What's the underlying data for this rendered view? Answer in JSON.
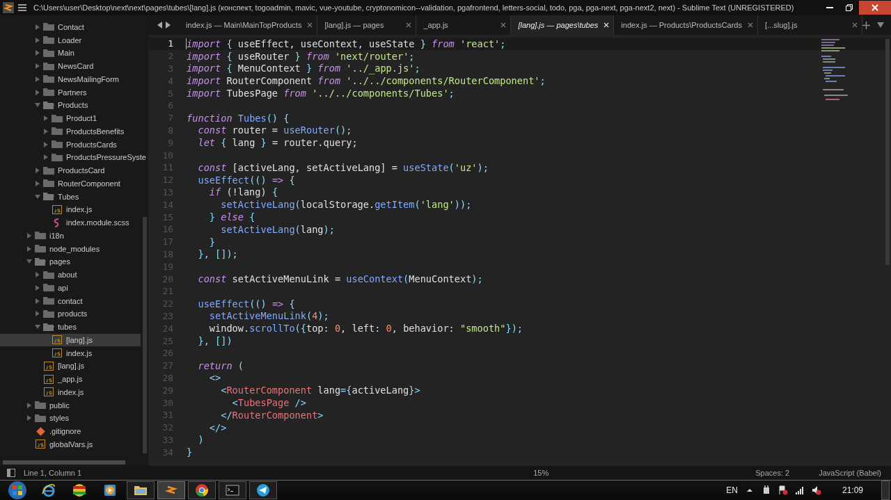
{
  "window": {
    "title": "C:\\Users\\user\\Desktop\\next\\next\\pages\\tubes\\[lang].js (конспект, togoadmin, mavic, vue-youtube, cryptonomicon--validation, pgafrontend, letters-social, todo, pga, pga-next, pga-next2, next) - Sublime Text (UNREGISTERED)"
  },
  "sidebar": {
    "partial_folder_children": [
      {
        "kind": "folder",
        "name": "Contact",
        "expanded": false,
        "selected": false
      },
      {
        "kind": "folder",
        "name": "Loader",
        "expanded": false,
        "selected": false
      },
      {
        "kind": "folder",
        "name": "Main",
        "expanded": false,
        "selected": false
      },
      {
        "kind": "folder",
        "name": "NewsCard",
        "expanded": false,
        "selected": false
      },
      {
        "kind": "folder",
        "name": "NewsMailingForm",
        "expanded": false,
        "selected": false
      },
      {
        "kind": "folder",
        "name": "Partners",
        "expanded": false,
        "selected": false
      },
      {
        "kind": "folder",
        "name": "Products",
        "expanded": true,
        "selected": false,
        "children": [
          {
            "kind": "folder",
            "name": "Product1",
            "expanded": false,
            "selected": false
          },
          {
            "kind": "folder",
            "name": "ProductsBenefits",
            "expanded": false,
            "selected": false
          },
          {
            "kind": "folder",
            "name": "ProductsCards",
            "expanded": false,
            "selected": false
          },
          {
            "kind": "folder",
            "name": "ProductsPressureSyste",
            "expanded": false,
            "selected": false
          }
        ]
      },
      {
        "kind": "folder",
        "name": "ProductsCard",
        "expanded": false,
        "selected": false
      },
      {
        "kind": "folder",
        "name": "RouterComponent",
        "expanded": false,
        "selected": false
      },
      {
        "kind": "folder",
        "name": "Tubes",
        "expanded": true,
        "selected": false,
        "children": [
          {
            "kind": "js",
            "name": "index.js",
            "selected": false
          },
          {
            "kind": "scss",
            "name": "index.module.scss",
            "selected": false
          }
        ]
      }
    ],
    "items": [
      {
        "kind": "folder",
        "name": "i18n",
        "expanded": false,
        "selected": false
      },
      {
        "kind": "folder",
        "name": "node_modules",
        "expanded": false,
        "selected": false
      },
      {
        "kind": "folder",
        "name": "pages",
        "expanded": true,
        "selected": false,
        "children": [
          {
            "kind": "folder",
            "name": "about",
            "expanded": false,
            "selected": false
          },
          {
            "kind": "folder",
            "name": "api",
            "expanded": false,
            "selected": false
          },
          {
            "kind": "folder",
            "name": "contact",
            "expanded": false,
            "selected": false
          },
          {
            "kind": "folder",
            "name": "products",
            "expanded": false,
            "selected": false
          },
          {
            "kind": "folder",
            "name": "tubes",
            "expanded": true,
            "selected": false,
            "children": [
              {
                "kind": "js",
                "name": "[lang].js",
                "selected": true
              },
              {
                "kind": "js",
                "name": "index.js",
                "selected": false
              }
            ]
          },
          {
            "kind": "js",
            "name": "[lang].js",
            "selected": false
          },
          {
            "kind": "js",
            "name": "_app.js",
            "selected": false
          },
          {
            "kind": "js",
            "name": "index.js",
            "selected": false
          }
        ]
      },
      {
        "kind": "folder",
        "name": "public",
        "expanded": false,
        "selected": false
      },
      {
        "kind": "folder",
        "name": "styles",
        "expanded": false,
        "selected": false
      },
      {
        "kind": "git",
        "name": ".gitignore",
        "selected": false
      },
      {
        "kind": "js",
        "name": "globalVars.js",
        "selected": false
      }
    ]
  },
  "tabs": [
    {
      "label": "index.js — Main\\MainTopProducts",
      "selected": false
    },
    {
      "label": "[lang].js — pages",
      "selected": false
    },
    {
      "label": "_app.js",
      "selected": false
    },
    {
      "label": "[lang].js — pages\\tubes",
      "selected": true
    },
    {
      "label": "index.js — Products\\ProductsCards",
      "selected": false
    },
    {
      "label": "[...slug].js",
      "selected": false
    }
  ],
  "editor": {
    "lines": [
      {
        "number": "1",
        "current": true,
        "tokens": [
          {
            "kind": "kw",
            "text": "import"
          },
          {
            "kind": "p",
            "text": " { "
          },
          {
            "kind": "pl",
            "text": "useEffect, useContext, useState"
          },
          {
            "kind": "p",
            "text": " } "
          },
          {
            "kind": "kw",
            "text": "from"
          },
          {
            "kind": "str",
            "text": " 'react'"
          },
          {
            "kind": "p",
            "text": ";"
          }
        ]
      },
      {
        "number": "2",
        "current": false,
        "tokens": [
          {
            "kind": "kw",
            "text": "import"
          },
          {
            "kind": "p",
            "text": " { "
          },
          {
            "kind": "pl",
            "text": "useRouter"
          },
          {
            "kind": "p",
            "text": " } "
          },
          {
            "kind": "kw",
            "text": "from"
          },
          {
            "kind": "str",
            "text": " 'next/router'"
          },
          {
            "kind": "p",
            "text": ";"
          }
        ]
      },
      {
        "number": "3",
        "current": false,
        "tokens": [
          {
            "kind": "kw",
            "text": "import"
          },
          {
            "kind": "p",
            "text": " { "
          },
          {
            "kind": "pl",
            "text": "MenuContext"
          },
          {
            "kind": "p",
            "text": " } "
          },
          {
            "kind": "kw",
            "text": "from"
          },
          {
            "kind": "str",
            "text": " '../_app.js'"
          },
          {
            "kind": "p",
            "text": ";"
          }
        ]
      },
      {
        "number": "4",
        "current": false,
        "tokens": [
          {
            "kind": "kw",
            "text": "import"
          },
          {
            "kind": "pl",
            "text": " RouterComponent "
          },
          {
            "kind": "kw",
            "text": "from"
          },
          {
            "kind": "str",
            "text": " '../../components/RouterComponent'"
          },
          {
            "kind": "p",
            "text": ";"
          }
        ]
      },
      {
        "number": "5",
        "current": false,
        "tokens": [
          {
            "kind": "kw",
            "text": "import"
          },
          {
            "kind": "pl",
            "text": " TubesPage "
          },
          {
            "kind": "kw",
            "text": "from"
          },
          {
            "kind": "str",
            "text": " '../../components/Tubes'"
          },
          {
            "kind": "p",
            "text": ";"
          }
        ]
      },
      {
        "number": "6",
        "current": false
      },
      {
        "number": "7",
        "current": false,
        "tokens": [
          {
            "kind": "kw",
            "text": "function"
          },
          {
            "kind": "fn",
            "text": " Tubes"
          },
          {
            "kind": "p",
            "text": "() {"
          }
        ]
      },
      {
        "number": "8",
        "current": false,
        "tokens": [
          {
            "kind": "kw",
            "text": "  const"
          },
          {
            "kind": "pl",
            "text": " router = "
          },
          {
            "kind": "fn",
            "text": "useRouter"
          },
          {
            "kind": "p",
            "text": "();"
          }
        ]
      },
      {
        "number": "9",
        "current": false,
        "tokens": [
          {
            "kind": "kw",
            "text": "  let"
          },
          {
            "kind": "p",
            "text": " { "
          },
          {
            "kind": "pl",
            "text": "lang"
          },
          {
            "kind": "p",
            "text": " } "
          },
          {
            "kind": "pl",
            "text": "= router.query;"
          }
        ]
      },
      {
        "number": "10",
        "current": false
      },
      {
        "number": "11",
        "current": false,
        "tokens": [
          {
            "kind": "kw",
            "text": "  const"
          },
          {
            "kind": "pl",
            "text": " [activeLang, setActiveLang] = "
          },
          {
            "kind": "fn",
            "text": "useState"
          },
          {
            "kind": "p",
            "text": "("
          },
          {
            "kind": "str",
            "text": "'uz'"
          },
          {
            "kind": "p",
            "text": ");"
          }
        ]
      },
      {
        "number": "12",
        "current": false,
        "tokens": [
          {
            "kind": "fn",
            "text": "  useEffect"
          },
          {
            "kind": "p",
            "text": "(() "
          },
          {
            "kind": "kw",
            "text": "=>"
          },
          {
            "kind": "p",
            "text": " {"
          }
        ]
      },
      {
        "number": "13",
        "current": false,
        "tokens": [
          {
            "kind": "kw",
            "text": "    if"
          },
          {
            "kind": "pl",
            "text": " (!lang) "
          },
          {
            "kind": "p",
            "text": "{"
          }
        ]
      },
      {
        "number": "14",
        "current": false,
        "tokens": [
          {
            "kind": "fn",
            "text": "      setActiveLang"
          },
          {
            "kind": "p",
            "text": "("
          },
          {
            "kind": "pl",
            "text": "localStorage."
          },
          {
            "kind": "fn",
            "text": "getItem"
          },
          {
            "kind": "p",
            "text": "("
          },
          {
            "kind": "str",
            "text": "'lang'"
          },
          {
            "kind": "p",
            "text": "));"
          }
        ]
      },
      {
        "number": "15",
        "current": false,
        "tokens": [
          {
            "kind": "p",
            "text": "    } "
          },
          {
            "kind": "kw",
            "text": "else"
          },
          {
            "kind": "p",
            "text": " {"
          }
        ]
      },
      {
        "number": "16",
        "current": false,
        "tokens": [
          {
            "kind": "fn",
            "text": "      setActiveLang"
          },
          {
            "kind": "p",
            "text": "("
          },
          {
            "kind": "pl",
            "text": "lang"
          },
          {
            "kind": "p",
            "text": ");"
          }
        ]
      },
      {
        "number": "17",
        "current": false,
        "tokens": [
          {
            "kind": "p",
            "text": "    }"
          }
        ]
      },
      {
        "number": "18",
        "current": false,
        "tokens": [
          {
            "kind": "p",
            "text": "  }, []);"
          }
        ]
      },
      {
        "number": "19",
        "current": false
      },
      {
        "number": "20",
        "current": false,
        "tokens": [
          {
            "kind": "kw",
            "text": "  const"
          },
          {
            "kind": "pl",
            "text": " setActiveMenuLink = "
          },
          {
            "kind": "fn",
            "text": "useContext"
          },
          {
            "kind": "p",
            "text": "("
          },
          {
            "kind": "pl",
            "text": "MenuContext"
          },
          {
            "kind": "p",
            "text": ");"
          }
        ]
      },
      {
        "number": "21",
        "current": false
      },
      {
        "number": "22",
        "current": false,
        "tokens": [
          {
            "kind": "fn",
            "text": "  useEffect"
          },
          {
            "kind": "p",
            "text": "(() "
          },
          {
            "kind": "kw",
            "text": "=>"
          },
          {
            "kind": "p",
            "text": " {"
          }
        ]
      },
      {
        "number": "23",
        "current": false,
        "tokens": [
          {
            "kind": "fn",
            "text": "    setActiveMenuLink"
          },
          {
            "kind": "p",
            "text": "("
          },
          {
            "kind": "num",
            "text": "4"
          },
          {
            "kind": "p",
            "text": ");"
          }
        ]
      },
      {
        "number": "24",
        "current": false,
        "tokens": [
          {
            "kind": "pl",
            "text": "    window."
          },
          {
            "kind": "fn",
            "text": "scrollTo"
          },
          {
            "kind": "p",
            "text": "({"
          },
          {
            "kind": "pl",
            "text": "top: "
          },
          {
            "kind": "num",
            "text": "0"
          },
          {
            "kind": "pl",
            "text": ", left: "
          },
          {
            "kind": "num",
            "text": "0"
          },
          {
            "kind": "pl",
            "text": ", behavior: "
          },
          {
            "kind": "str",
            "text": "\"smooth\""
          },
          {
            "kind": "p",
            "text": "});"
          }
        ]
      },
      {
        "number": "25",
        "current": false,
        "tokens": [
          {
            "kind": "p",
            "text": "  }, [])"
          }
        ]
      },
      {
        "number": "26",
        "current": false
      },
      {
        "number": "27",
        "current": false,
        "tokens": [
          {
            "kind": "kw",
            "text": "  return"
          },
          {
            "kind": "p",
            "text": " ("
          }
        ]
      },
      {
        "number": "28",
        "current": false,
        "tokens": [
          {
            "kind": "p",
            "text": "    <>"
          }
        ]
      },
      {
        "number": "29",
        "current": false,
        "tokens": [
          {
            "kind": "p",
            "text": "      <"
          },
          {
            "kind": "tag",
            "text": "RouterComponent"
          },
          {
            "kind": "pl",
            "text": " lang"
          },
          {
            "kind": "p",
            "text": "={"
          },
          {
            "kind": "pl",
            "text": "activeLang"
          },
          {
            "kind": "p",
            "text": "}>"
          }
        ]
      },
      {
        "number": "30",
        "current": false,
        "tokens": [
          {
            "kind": "p",
            "text": "        <"
          },
          {
            "kind": "tag",
            "text": "TubesPage"
          },
          {
            "kind": "p",
            "text": " />"
          }
        ]
      },
      {
        "number": "31",
        "current": false,
        "tokens": [
          {
            "kind": "p",
            "text": "      </"
          },
          {
            "kind": "tag",
            "text": "RouterComponent"
          },
          {
            "kind": "p",
            "text": ">"
          }
        ]
      },
      {
        "number": "32",
        "current": false,
        "tokens": [
          {
            "kind": "p",
            "text": "    </>"
          }
        ]
      },
      {
        "number": "33",
        "current": false,
        "tokens": [
          {
            "kind": "p",
            "text": "  )"
          }
        ]
      },
      {
        "number": "34",
        "current": false,
        "tokens": [
          {
            "kind": "p",
            "text": "}"
          }
        ]
      }
    ]
  },
  "status_bar": {
    "position": "Line 1, Column 1",
    "zoom": "15%",
    "indentation": "Spaces: 2",
    "syntax": "JavaScript (Babel)"
  },
  "taskbar": {
    "apps": [
      {
        "kind": "ie",
        "active": false,
        "selected": false
      },
      {
        "kind": "rainbow",
        "active": false,
        "selected": false
      },
      {
        "kind": "media",
        "active": false,
        "selected": false
      },
      {
        "kind": "explorer",
        "active": true,
        "selected": false
      },
      {
        "kind": "sublime",
        "active": true,
        "selected": true
      },
      {
        "kind": "chrome",
        "active": true,
        "selected": false
      },
      {
        "kind": "cmd",
        "active": true,
        "selected": false
      },
      {
        "kind": "telegram",
        "active": true,
        "selected": false
      }
    ],
    "language": "EN",
    "clock": "21:09"
  }
}
